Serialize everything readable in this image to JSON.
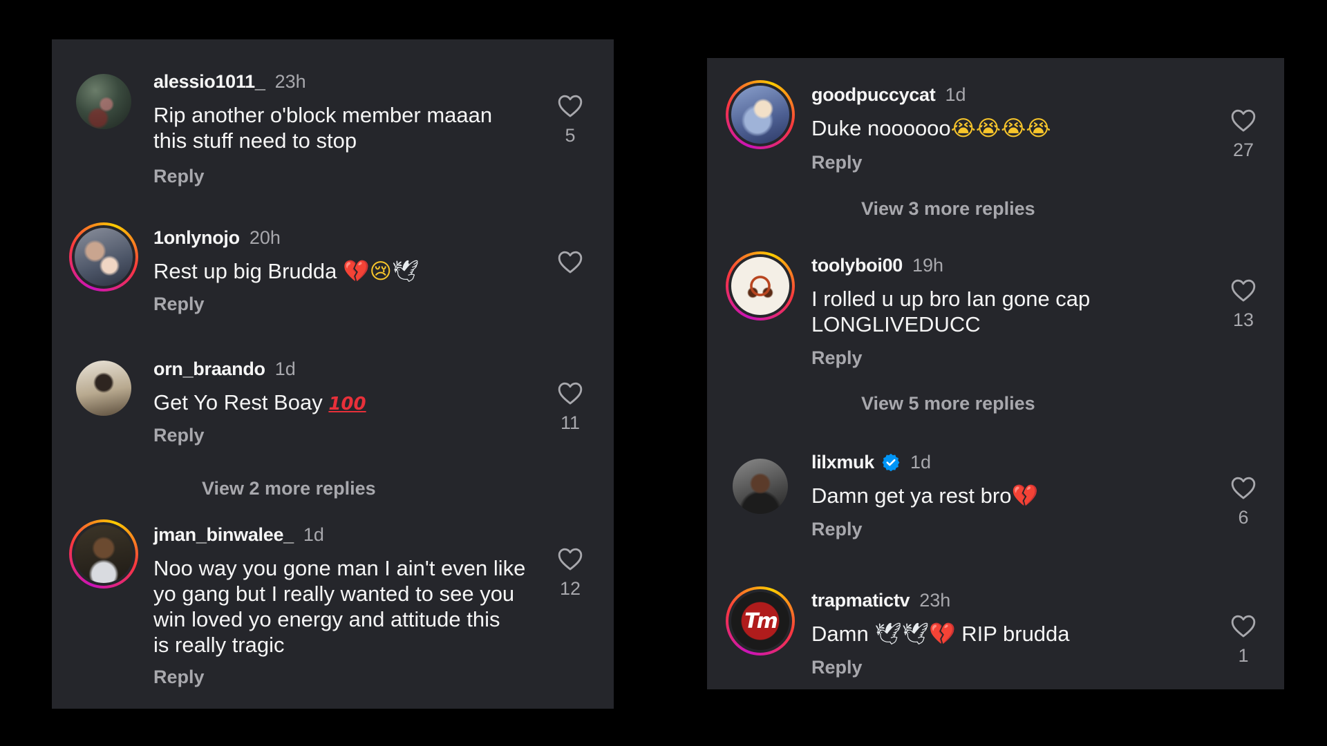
{
  "left_panel": {
    "comments": [
      {
        "username": "alessio1011_",
        "time": "23h",
        "text_lines": [
          "Rip another o'block member maaan",
          "this stuff need to stop"
        ],
        "reply_label": "Reply",
        "likes": "5",
        "avatar": "photo"
      },
      {
        "username": "1onlynojo",
        "time": "20h",
        "text_lines": [
          "Rest up big Brudda"
        ],
        "emoji": [
          "broken-heart",
          "crying-face",
          "dove"
        ],
        "reply_label": "Reply",
        "likes": "",
        "avatar": "story-ring"
      },
      {
        "username": "orn_braando",
        "time": "1d",
        "text_lines": [
          "Get Yo Rest Boay"
        ],
        "emoji": [
          "hundred-points"
        ],
        "reply_label": "Reply",
        "likes": "11",
        "avatar": "photo",
        "view_more": "View 2 more replies"
      },
      {
        "username": "jman_binwalee_",
        "time": "1d",
        "text_lines": [
          "Noo way you gone man I ain't even like",
          "yo gang but I really wanted to see you",
          "win loved yo energy and attitude this",
          "is really tragic"
        ],
        "reply_label": "Reply",
        "likes": "12",
        "avatar": "story-ring"
      }
    ]
  },
  "right_panel": {
    "comments": [
      {
        "username": "goodpuccycat",
        "time": "1d",
        "text_lines": [
          "Duke noooooo"
        ],
        "emoji": [
          "loudly-crying-face",
          "loudly-crying-face",
          "loudly-crying-face",
          "loudly-crying-face"
        ],
        "reply_label": "Reply",
        "likes": "27",
        "avatar": "story-ring",
        "view_more": "View 3 more replies"
      },
      {
        "username": "toolyboi00",
        "time": "19h",
        "text_lines": [
          "I rolled u up bro Ian gone cap",
          "LONGLIVEDUCC"
        ],
        "reply_label": "Reply",
        "likes": "13",
        "avatar": "story-ring",
        "view_more": "View 5 more replies"
      },
      {
        "username": "lilxmuk",
        "verified": true,
        "time": "1d",
        "text_lines": [
          "Damn get ya rest bro"
        ],
        "emoji": [
          "broken-heart"
        ],
        "reply_label": "Reply",
        "likes": "6",
        "avatar": "photo"
      },
      {
        "username": "trapmatictv",
        "time": "23h",
        "text_lines": [
          "Damn"
        ],
        "emoji": [
          "dove",
          "dove",
          "broken-heart"
        ],
        "text_suffix": " RIP brudda",
        "reply_label": "Reply",
        "likes": "1",
        "avatar": "story-ring"
      }
    ]
  },
  "colors": {
    "background": "#000000",
    "panel": "#25262b",
    "primary_text": "#f5f5f5",
    "secondary_text": "#a8a8ad",
    "verified_badge": "#0095f6"
  },
  "icons": {
    "like": "heart-outline-icon",
    "verified": "verified-badge-icon"
  }
}
